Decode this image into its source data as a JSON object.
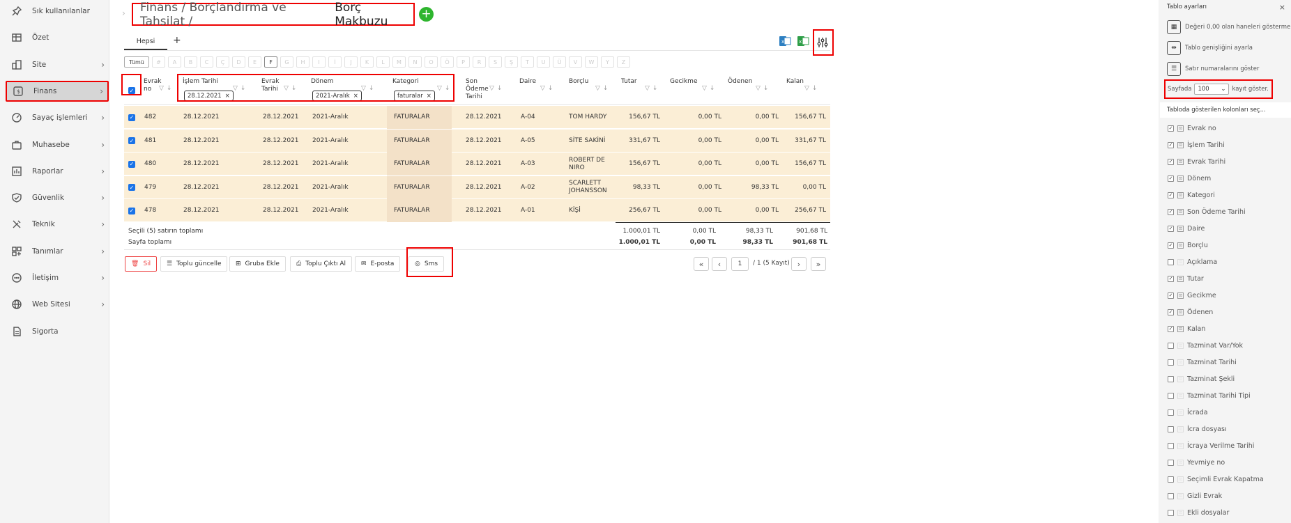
{
  "sidebar": {
    "items": [
      {
        "label": "Sık kullanılanlar",
        "icon": "pin-icon",
        "chevron": false
      },
      {
        "label": "Özet",
        "icon": "table-icon",
        "chevron": false
      },
      {
        "label": "Site",
        "icon": "building-icon",
        "chevron": true
      },
      {
        "label": "Finans",
        "icon": "finance-icon",
        "chevron": true,
        "active": true
      },
      {
        "label": "Sayaç işlemleri",
        "icon": "gauge-icon",
        "chevron": true
      },
      {
        "label": "Muhasebe",
        "icon": "briefcase-icon",
        "chevron": true
      },
      {
        "label": "Raporlar",
        "icon": "chart-icon",
        "chevron": true
      },
      {
        "label": "Güvenlik",
        "icon": "shield-icon",
        "chevron": true
      },
      {
        "label": "Teknik",
        "icon": "tools-icon",
        "chevron": true
      },
      {
        "label": "Tanımlar",
        "icon": "grid-icon",
        "chevron": true
      },
      {
        "label": "İletişim",
        "icon": "chat-icon",
        "chevron": true
      },
      {
        "label": "Web Sitesi",
        "icon": "globe-icon",
        "chevron": true
      },
      {
        "label": "Sigorta",
        "icon": "document-icon",
        "chevron": false
      }
    ]
  },
  "header": {
    "crumb1": "Finans / Borçlandırma ve Tahsilat / ",
    "crumb2": "Borç Makbuzu",
    "add": "+"
  },
  "tabs": {
    "all": "Hepsi",
    "add": "+"
  },
  "letters": [
    "Tümü",
    "A",
    "B",
    "C",
    "Ç",
    "D",
    "E",
    "F",
    "G",
    "H",
    "I",
    "İ",
    "J",
    "K",
    "L",
    "M",
    "N",
    "O",
    "Ö",
    "P",
    "R",
    "S",
    "Ş",
    "T",
    "U",
    "Ü",
    "V",
    "W",
    "Y",
    "Z"
  ],
  "letter_placeholder": "#",
  "selected_letter": "F",
  "table": {
    "headers": {
      "evrak_no": "Evrak no",
      "islem_tarihi": "İşlem Tarihi",
      "evrak_tarihi": "Evrak Tarihi",
      "donem": "Dönem",
      "kategori": "Kategori",
      "son_odeme": "Son Ödeme Tarihi",
      "daire": "Daire",
      "borclu": "Borçlu",
      "tutar": "Tutar",
      "gecikme": "Gecikme",
      "odenen": "Ödenen",
      "kalan": "Kalan"
    },
    "filters": {
      "islem_tarihi": "28.12.2021",
      "donem": "2021-Aralık",
      "kategori": "faturalar"
    },
    "rows": [
      {
        "no": "482",
        "islem": "28.12.2021",
        "evrak": "28.12.2021",
        "donem": "2021-Aralık",
        "kategori": "FATURALAR",
        "son": "28.12.2021",
        "daire": "A-04",
        "borclu": "TOM HARDY",
        "tutar": "156,67 TL",
        "gecikme": "0,00 TL",
        "odenen": "0,00 TL",
        "kalan": "156,67 TL"
      },
      {
        "no": "481",
        "islem": "28.12.2021",
        "evrak": "28.12.2021",
        "donem": "2021-Aralık",
        "kategori": "FATURALAR",
        "son": "28.12.2021",
        "daire": "A-05",
        "borclu": "SİTE SAKİNİ",
        "tutar": "331,67 TL",
        "gecikme": "0,00 TL",
        "odenen": "0,00 TL",
        "kalan": "331,67 TL"
      },
      {
        "no": "480",
        "islem": "28.12.2021",
        "evrak": "28.12.2021",
        "donem": "2021-Aralık",
        "kategori": "FATURALAR",
        "son": "28.12.2021",
        "daire": "A-03",
        "borclu": "ROBERT DE NIRO",
        "tutar": "156,67 TL",
        "gecikme": "0,00 TL",
        "odenen": "0,00 TL",
        "kalan": "156,67 TL"
      },
      {
        "no": "479",
        "islem": "28.12.2021",
        "evrak": "28.12.2021",
        "donem": "2021-Aralık",
        "kategori": "FATURALAR",
        "son": "28.12.2021",
        "daire": "A-02",
        "borclu": "SCARLETT JOHANSSON",
        "tutar": "98,33 TL",
        "gecikme": "0,00 TL",
        "odenen": "98,33 TL",
        "kalan": "0,00 TL"
      },
      {
        "no": "478",
        "islem": "28.12.2021",
        "evrak": "28.12.2021",
        "donem": "2021-Aralık",
        "kategori": "FATURALAR",
        "son": "28.12.2021",
        "daire": "A-01",
        "borclu": "KİŞİ",
        "tutar": "256,67 TL",
        "gecikme": "0,00 TL",
        "odenen": "0,00 TL",
        "kalan": "256,67 TL"
      }
    ],
    "totals": {
      "selected_label": "Seçili (5) satırın toplamı",
      "page_label": "Sayfa toplamı",
      "selected": {
        "tutar": "1.000,01 TL",
        "gecikme": "0,00 TL",
        "odenen": "98,33 TL",
        "kalan": "901,68 TL"
      },
      "page": {
        "tutar": "1.000,01 TL",
        "gecikme": "0,00 TL",
        "odenen": "98,33 TL",
        "kalan": "901,68 TL"
      }
    }
  },
  "actions": {
    "delete": "Sil",
    "bulk_update": "Toplu güncelle",
    "add_group": "Gruba Ekle",
    "bulk_print": "Toplu Çıktı Al",
    "email": "E-posta",
    "sms": "Sms"
  },
  "pagination": {
    "page": "1",
    "info": "/ 1 (5 Kayıt)"
  },
  "settings_panel": {
    "title": "Tablo ayarları",
    "close": "×",
    "opt_hide_zero": "Değeri 0,00 olan haneleri gösterme",
    "opt_width": "Tablo genişliğini ayarla",
    "opt_rownum": "Satır numaralarını göster",
    "page_prefix": "Sayfada",
    "page_size": "100",
    "page_suffix": "kayıt göster.",
    "columns_title": "Tabloda gösterilen kolonları seç...",
    "columns": [
      {
        "label": "Evrak no",
        "checked": true
      },
      {
        "label": "İşlem Tarihi",
        "checked": true
      },
      {
        "label": "Evrak Tarihi",
        "checked": true
      },
      {
        "label": "Dönem",
        "checked": true
      },
      {
        "label": "Kategori",
        "checked": true
      },
      {
        "label": "Son Ödeme Tarihi",
        "checked": true
      },
      {
        "label": "Daire",
        "checked": true
      },
      {
        "label": "Borçlu",
        "checked": true
      },
      {
        "label": "Açıklama",
        "checked": false
      },
      {
        "label": "Tutar",
        "checked": true
      },
      {
        "label": "Gecikme",
        "checked": true
      },
      {
        "label": "Ödenen",
        "checked": true
      },
      {
        "label": "Kalan",
        "checked": true
      },
      {
        "label": "Tazminat Var/Yok",
        "checked": false
      },
      {
        "label": "Tazminat Tarihi",
        "checked": false
      },
      {
        "label": "Tazminat Şekli",
        "checked": false
      },
      {
        "label": "Tazminat Tarihi Tipi",
        "checked": false
      },
      {
        "label": "İcrada",
        "checked": false
      },
      {
        "label": "İcra dosyası",
        "checked": false
      },
      {
        "label": "İcraya Verilme Tarihi",
        "checked": false
      },
      {
        "label": "Yevmiye no",
        "checked": false
      },
      {
        "label": "Seçimli Evrak Kapatma",
        "checked": false
      },
      {
        "label": "Gizli Evrak",
        "checked": false
      },
      {
        "label": "Ekli dosyalar",
        "checked": false
      }
    ]
  },
  "colors": {
    "accent": "#1a73e8",
    "highlight": "#e00000",
    "row": "#fbeed6",
    "add": "#2eb52e"
  }
}
